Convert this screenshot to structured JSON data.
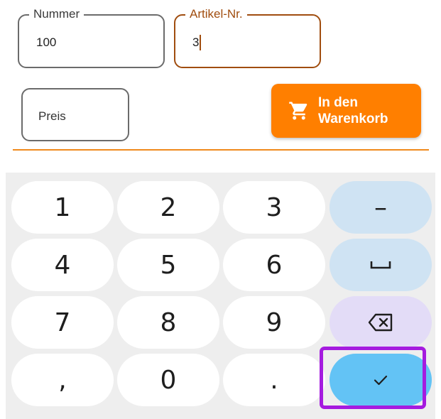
{
  "form": {
    "nummer": {
      "label": "Nummer",
      "value": "100"
    },
    "artikel": {
      "label": "Artikel-Nr.",
      "value": "3"
    },
    "preis": {
      "placeholder": "Preis"
    },
    "cart_button": {
      "label": "In den\nWarenkorb",
      "icon": "shopping-cart-icon",
      "color": "#ff7f00"
    }
  },
  "keypad": {
    "keys": [
      "1",
      "2",
      "3",
      "–",
      "4",
      "5",
      "6",
      "space",
      "7",
      "8",
      "9",
      "backspace",
      ",",
      "0",
      ".",
      "done"
    ],
    "row1": {
      "k1": "1",
      "k2": "2",
      "k3": "3",
      "k4": "–"
    },
    "row2": {
      "k1": "4",
      "k2": "5",
      "k3": "6"
    },
    "row3": {
      "k1": "7",
      "k2": "8",
      "k3": "9"
    },
    "row4": {
      "k1": ",",
      "k2": "0",
      "k3": "."
    },
    "icons": {
      "space": "space-bar-icon",
      "backspace": "backspace-icon",
      "done": "checkmark-icon"
    },
    "colors": {
      "action": "#cfe3f3",
      "delete": "#e3dcf7",
      "enter": "#63c3f5",
      "highlight": "#a51bdf"
    }
  }
}
